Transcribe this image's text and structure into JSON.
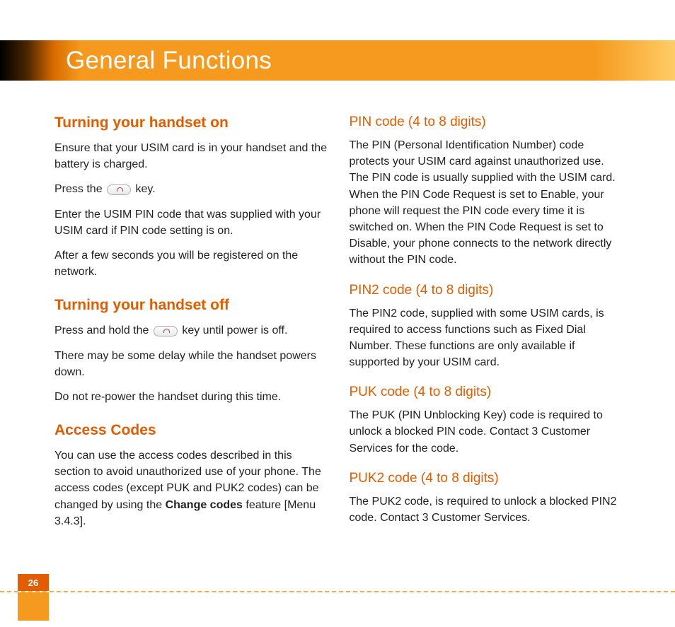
{
  "header": {
    "title": "General Functions"
  },
  "page_number": "26",
  "left": {
    "h_on": "Turning your handset on",
    "on_p1": "Ensure that your USIM card is in your handset and the battery is charged.",
    "on_p2_a": "Press the ",
    "on_p2_b": " key.",
    "on_p3": "Enter the USIM PIN code that was supplied with your USIM card if PIN code setting is on.",
    "on_p4": "After a few seconds you will be registered on the network.",
    "h_off": "Turning your handset off",
    "off_p1_a": "Press and hold the ",
    "off_p1_b": " key until power is off.",
    "off_p2": "There may be some delay while the handset powers down.",
    "off_p3": "Do not re-power the handset during this time.",
    "h_access": "Access Codes",
    "access_p1_a": "You can use the access codes described in this section to avoid unauthorized use of your phone. The access codes (except PUK and PUK2 codes) can be changed by using the ",
    "access_p1_bold": "Change codes",
    "access_p1_b": " feature [Menu 3.4.3]."
  },
  "right": {
    "h_pin": "PIN code (4 to 8 digits)",
    "pin_p1": "The PIN (Personal Identification Number) code protects your USIM card against unauthorized use. The PIN code is usually supplied with the USIM card. When the PIN Code Request is set to Enable, your phone will request the PIN code every time it is switched on. When the PIN Code Request is set to Disable, your phone connects to the network directly without the PIN code.",
    "h_pin2": "PIN2 code (4 to 8 digits)",
    "pin2_p1": "The PIN2 code, supplied with some USIM cards, is required to access functions such as Fixed Dial Number. These functions are only available if supported by your USIM card.",
    "h_puk": "PUK code (4 to 8 digits)",
    "puk_p1": "The PUK (PIN Unblocking Key) code is required to unlock a blocked PIN code. Contact 3 Customer Services for the code.",
    "h_puk2": "PUK2 code (4 to 8 digits)",
    "puk2_p1": "The PUK2 code, is required to unlock a blocked PIN2 code. Contact 3 Customer Services."
  }
}
